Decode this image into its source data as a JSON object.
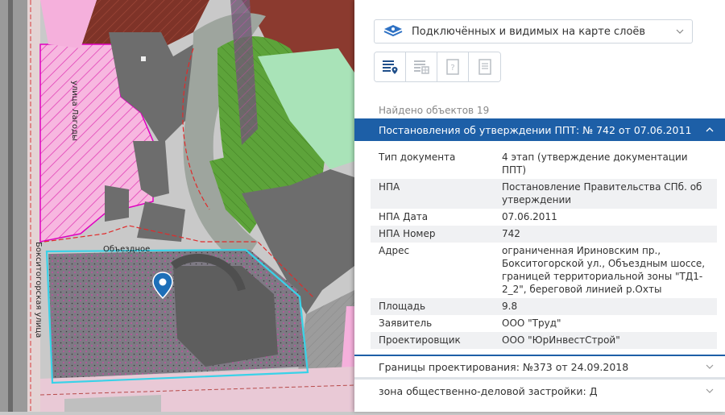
{
  "map": {
    "street_labels": [
      "улица Лагоды",
      "Бокситогорская улица",
      "Объездное"
    ],
    "colors": {
      "pink_zone": "#f5a9d9",
      "brown_zone": "#8b3a2f",
      "green_zone": "#6fae3c",
      "light_green_zone": "#a9e3b8",
      "grey_building": "#6d6d6d",
      "selection_outline": "#39d2e8",
      "marker": "#1d6fb8"
    },
    "icons": [
      "location-pin-icon"
    ]
  },
  "panel": {
    "layer_select": {
      "label": "Подключённых и видимых на карте слоёв",
      "icon": "layers-icon"
    },
    "toolbar": {
      "tools": [
        {
          "name": "list-location-icon",
          "active": true
        },
        {
          "name": "list-grid-icon",
          "active": false
        },
        {
          "name": "question-doc-icon",
          "active": false
        },
        {
          "name": "document-icon",
          "active": false
        }
      ]
    },
    "found_count_text": "Найдено объектов 19",
    "section": {
      "title": "Постановления об утверждении ППТ: № 742 от 07.06.2011",
      "expanded": true,
      "rows": [
        {
          "key": "Тип документа",
          "value": "4 этап (утверждение документации ППТ)"
        },
        {
          "key": "НПА",
          "value": "Постановление Правительства СПб. об утверждении"
        },
        {
          "key": "НПА Дата",
          "value": "07.06.2011"
        },
        {
          "key": "НПА Номер",
          "value": "742"
        },
        {
          "key": "Адрес",
          "value": "ограниченная Ириновским пр., Бокситогорской ул., Объездным шоссе, границей территориальной зоны \"ТД1-2_2\", береговой линией р.Охты"
        },
        {
          "key": "Площадь",
          "value": "9.8"
        },
        {
          "key": "Заявитель",
          "value": "ООО \"Труд\""
        },
        {
          "key": "Проектировщик",
          "value": "ООО \"ЮрИнвестСтрой\""
        }
      ]
    },
    "collapsed_items": [
      "Границы проектирования: №373 от 24.09.2018",
      "зона общественно-деловой застройки: Д"
    ],
    "accent_color": "#1d5fa7"
  }
}
